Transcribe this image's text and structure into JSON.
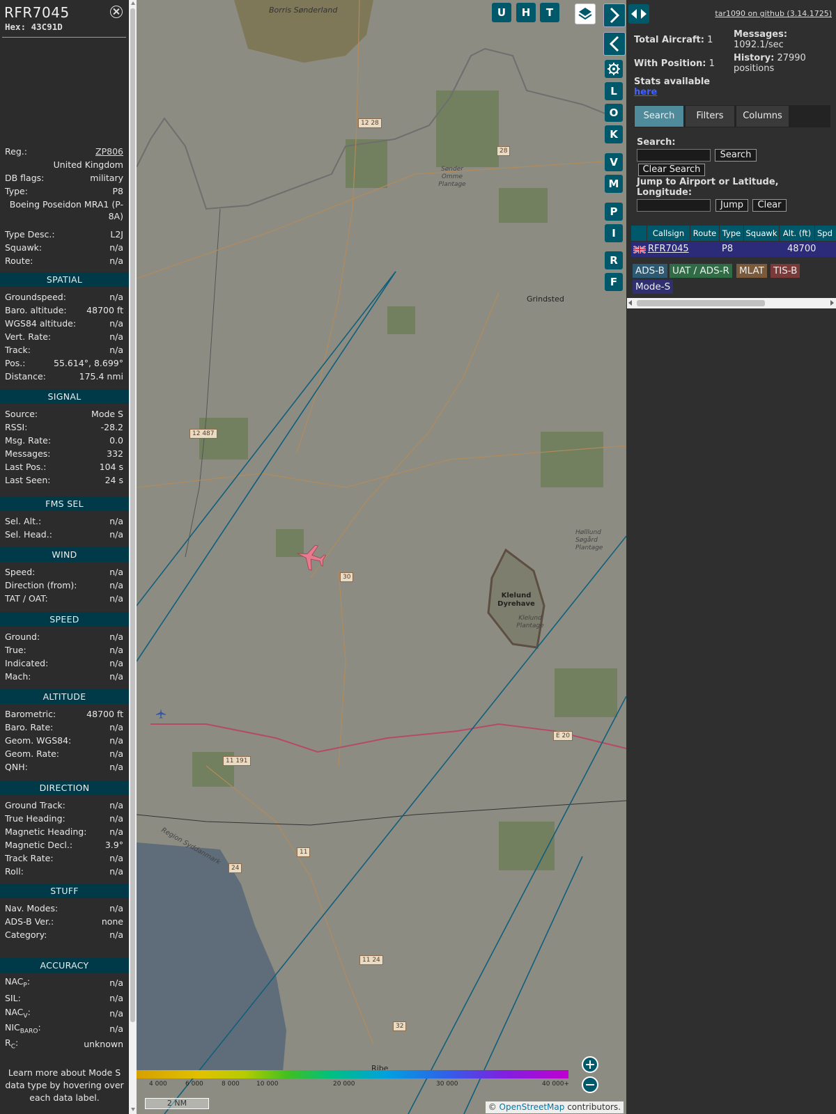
{
  "aircraft": {
    "callsign": "RFR7045",
    "hex": "Hex: 43C91D",
    "reg_label": "Reg.:",
    "reg": "ZP806",
    "country": "United Kingdom",
    "db_flags_label": "DB flags:",
    "db_flags": "military",
    "type_label": "Type:",
    "type": "P8",
    "type_name": "Boeing Poseidon MRA1 (P-8A)",
    "type_desc_label": "Type Desc.:",
    "type_desc": "L2J",
    "squawk_label": "Squawk:",
    "squawk": "n/a",
    "route_label": "Route:",
    "route": "n/a"
  },
  "sections": {
    "spatial": {
      "title": "SPATIAL",
      "rows": [
        {
          "label": "Groundspeed:",
          "value": "n/a"
        },
        {
          "label": "Baro. altitude:",
          "value": "48700 ft"
        },
        {
          "label": "WGS84 altitude:",
          "value": "n/a"
        },
        {
          "label": "Vert. Rate:",
          "value": "n/a"
        },
        {
          "label": "Track:",
          "value": "n/a"
        },
        {
          "label": "Pos.:",
          "value": "55.614°, 8.699°"
        },
        {
          "label": "Distance:",
          "value": "175.4 nmi"
        }
      ]
    },
    "signal": {
      "title": "SIGNAL",
      "rows": [
        {
          "label": "Source:",
          "value": "Mode S"
        },
        {
          "label": "RSSI:",
          "value": "-28.2"
        },
        {
          "label": "Msg. Rate:",
          "value": "0.0"
        },
        {
          "label": "Messages:",
          "value": "332"
        },
        {
          "label": "Last Pos.:",
          "value": "104 s"
        },
        {
          "label": "Last Seen:",
          "value": "24 s"
        }
      ]
    },
    "fms": {
      "title": "FMS SEL",
      "rows": [
        {
          "label": "Sel. Alt.:",
          "value": "n/a"
        },
        {
          "label": "Sel. Head.:",
          "value": "n/a"
        }
      ]
    },
    "wind": {
      "title": "WIND",
      "rows": [
        {
          "label": "Speed:",
          "value": "n/a"
        },
        {
          "label": "Direction (from):",
          "value": "n/a"
        },
        {
          "label": "TAT / OAT:",
          "value": "n/a"
        }
      ]
    },
    "speed": {
      "title": "SPEED",
      "rows": [
        {
          "label": "Ground:",
          "value": "n/a"
        },
        {
          "label": "True:",
          "value": "n/a"
        },
        {
          "label": "Indicated:",
          "value": "n/a"
        },
        {
          "label": "Mach:",
          "value": "n/a"
        }
      ]
    },
    "altitude": {
      "title": "ALTITUDE",
      "rows": [
        {
          "label": "Barometric:",
          "value": "48700 ft"
        },
        {
          "label": "Baro. Rate:",
          "value": "n/a"
        },
        {
          "label": "Geom. WGS84:",
          "value": "n/a"
        },
        {
          "label": "Geom. Rate:",
          "value": "n/a"
        },
        {
          "label": "QNH:",
          "value": "n/a"
        }
      ]
    },
    "direction": {
      "title": "DIRECTION",
      "rows": [
        {
          "label": "Ground Track:",
          "value": "n/a"
        },
        {
          "label": "True Heading:",
          "value": "n/a"
        },
        {
          "label": "Magnetic Heading:",
          "value": "n/a"
        },
        {
          "label": "Magnetic Decl.:",
          "value": "3.9°"
        },
        {
          "label": "Track Rate:",
          "value": "n/a"
        },
        {
          "label": "Roll:",
          "value": "n/a"
        }
      ]
    },
    "stuff": {
      "title": "STUFF",
      "rows": [
        {
          "label": "Nav. Modes:",
          "value": "n/a"
        },
        {
          "label": "ADS-B Ver.:",
          "value": "none"
        },
        {
          "label": "Category:",
          "value": "n/a"
        }
      ]
    },
    "accuracy": {
      "title": "ACCURACY",
      "rows": [
        {
          "label": "NAC",
          "sub": "P",
          "value": "n/a"
        },
        {
          "label": "SIL:",
          "sub": "",
          "value": "n/a"
        },
        {
          "label": "NAC",
          "sub": "V",
          "value": "n/a"
        },
        {
          "label": "NIC",
          "sub": "BARO",
          "value": "n/a"
        },
        {
          "label": "R",
          "sub": "C",
          "value": "unknown"
        }
      ]
    }
  },
  "learn_more": "Learn more about Mode S data type by hovering over each data label.",
  "map": {
    "buttons_top": [
      "U",
      "H",
      "T"
    ],
    "buttons_side": [
      "L",
      "O",
      "K",
      "V",
      "M",
      "P",
      "I",
      "R",
      "F"
    ],
    "places": {
      "borris": "Borris Sønderland",
      "sonder": "Sønder Omme Plantage",
      "grindsted": "Grindsted",
      "hollund": "Hølllund Søgård Plantage",
      "klelund": "Klelund Dyrehave",
      "klelund_p": "Klelund Plantage",
      "ribe": "Ribe",
      "region": "Region Syddanmark"
    },
    "roads": [
      "12 28",
      "28",
      "12 487",
      "30",
      "11 191",
      "11",
      "24",
      "11 24",
      "32",
      "E 20"
    ],
    "altitude_legend": [
      "4 000",
      "6 000",
      "8 000",
      "10 000",
      "20 000",
      "30 000",
      "40 000+"
    ],
    "scale": "2 NM",
    "attribution_prefix": "© ",
    "attribution_link": "OpenStreetMap",
    "attribution_suffix": " contributors."
  },
  "stats": {
    "github": "tar1090 on github (3.14.1725)",
    "total_label": "Total Aircraft:",
    "total": "1",
    "position_label": "With Position:",
    "position": "1",
    "stats_label": "Stats available",
    "stats_link": "here",
    "messages_label": "Messages:",
    "messages": "1092.1/sec",
    "history_label": "History:",
    "history": "27990 positions"
  },
  "tabs": [
    "Search",
    "Filters",
    "Columns"
  ],
  "search": {
    "label": "Search:",
    "button": "Search",
    "clear": "Clear Search",
    "jump_label": "Jump to Airport or Latitude, Longitude:",
    "jump": "Jump",
    "jump_clear": "Clear"
  },
  "table": {
    "headers": [
      "Callsign",
      "Route",
      "Type",
      "Squawk",
      "Alt. (ft)",
      "Spd"
    ],
    "row": {
      "callsign": "RFR7045",
      "route": "",
      "type": "P8",
      "squawk": "",
      "alt": "48700"
    }
  },
  "source_legend": [
    "ADS-B",
    "UAT / ADS-R",
    "MLAT",
    "TIS-B",
    "Mode-S"
  ]
}
